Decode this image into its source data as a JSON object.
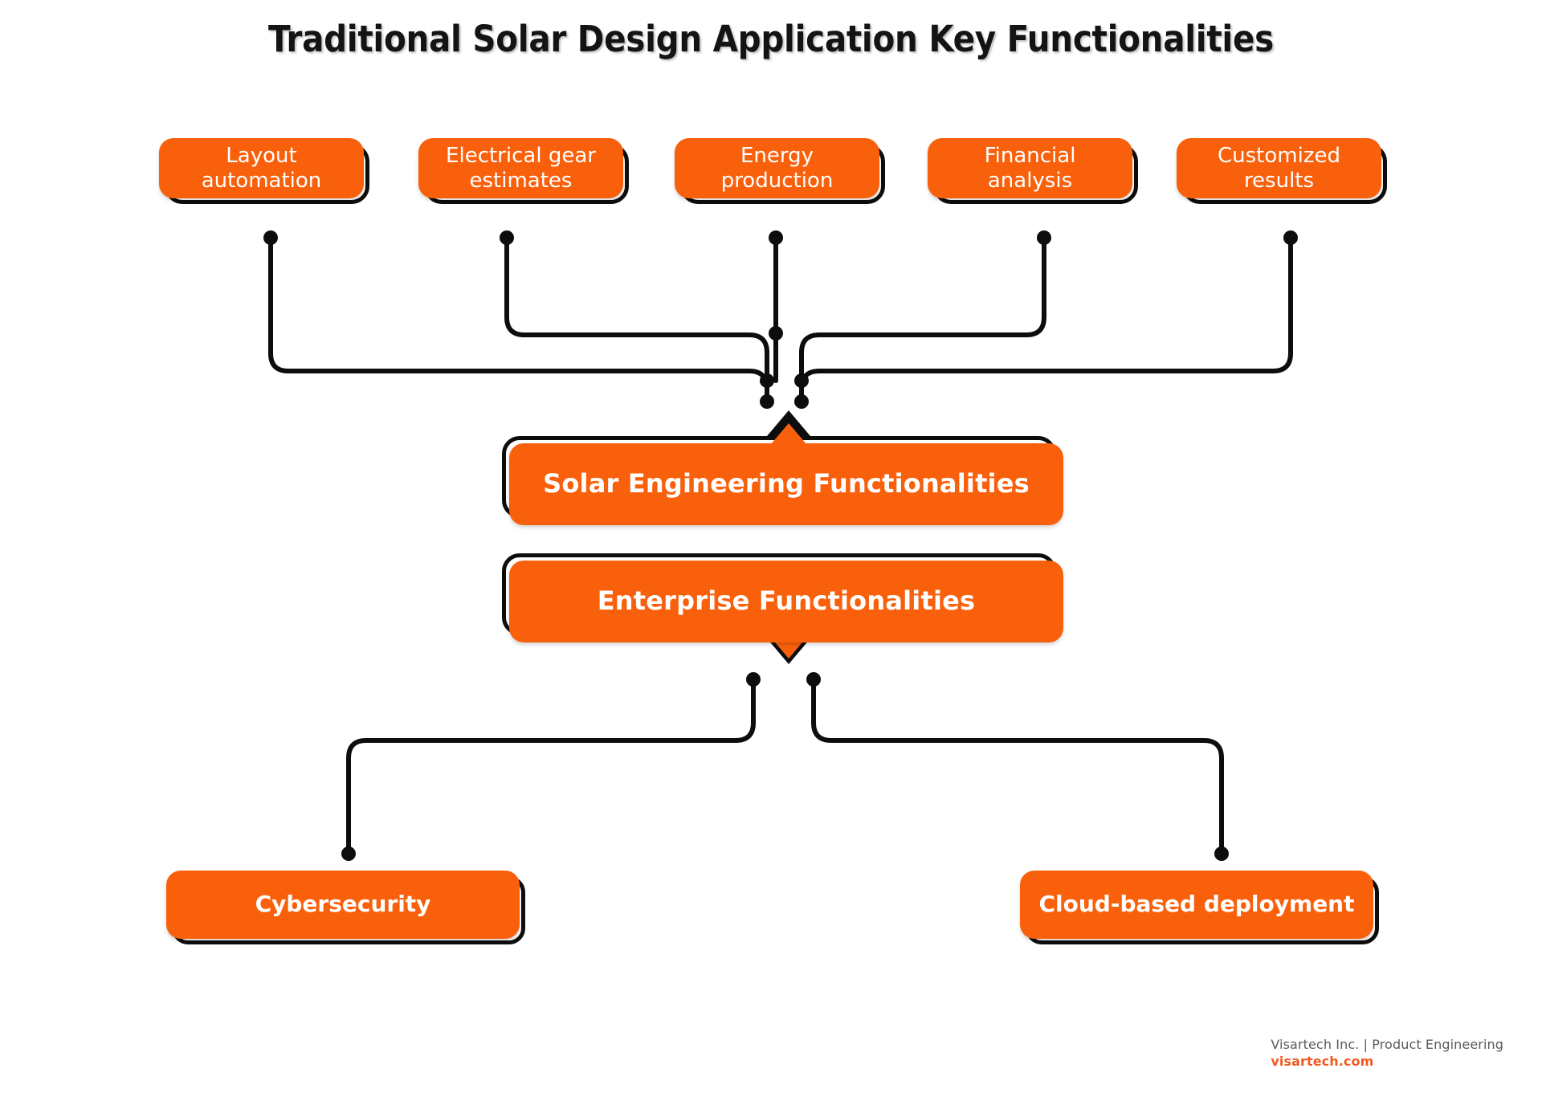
{
  "page": {
    "title": "Traditional Solar Design Application Key Functionalities",
    "background_color": "#FFFFFF",
    "accent_color": "#F9600B",
    "outline_color": "#0D0D0D",
    "text_color": "#FFFFFF"
  },
  "top_row": [
    {
      "line1": "Layout",
      "line2": "automation"
    },
    {
      "line1": "Electrical gear",
      "line2": "estimates"
    },
    {
      "line1": "Energy",
      "line2": "production"
    },
    {
      "line1": "Financial",
      "line2": "analysis"
    },
    {
      "line1": "Customized",
      "line2": "results"
    }
  ],
  "center_nodes": [
    {
      "label": "Solar Engineering Functionalities"
    },
    {
      "label": "Enterprise Functionalities"
    }
  ],
  "bottom_row": [
    {
      "label": "Cybersecurity"
    },
    {
      "label": "Cloud-based deployment"
    }
  ],
  "footer": {
    "company": "Visartech Inc. | Product Engineering",
    "website": "visartech.com",
    "company_color": "#5A5A5A",
    "website_color": "#F05A22"
  }
}
